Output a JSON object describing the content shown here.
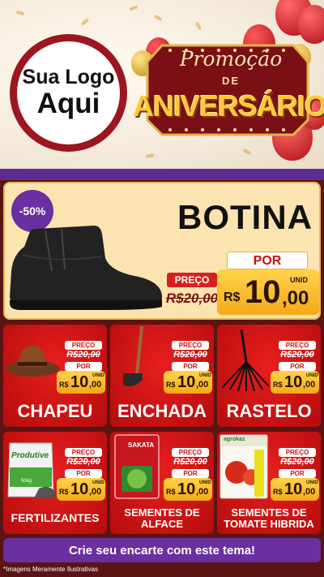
{
  "header": {
    "logo_line1": "Sua Logo",
    "logo_line2": "Aqui",
    "promo_top": "Promoção",
    "promo_de": "DE",
    "promo_main": "ANIVERSÁRIO"
  },
  "hero": {
    "discount": "-50%",
    "title": "BOTINA",
    "preco_label": "PREÇO",
    "old_price": "R$20,00",
    "por_label": "POR",
    "currency": "R$",
    "price_int": "10",
    "price_dec": ",00",
    "unit": "UNID"
  },
  "products": [
    {
      "title": "CHAPEU",
      "preco_label": "PREÇO",
      "old_price": "R$20,00",
      "por_label": "POR",
      "currency": "R$",
      "price_int": "10",
      "price_dec": ",00",
      "unit": "UNID"
    },
    {
      "title": "ENCHADA",
      "preco_label": "PREÇO",
      "old_price": "R$20,00",
      "por_label": "POR",
      "currency": "R$",
      "price_int": "10",
      "price_dec": ",00",
      "unit": "UNID"
    },
    {
      "title": "RASTELO",
      "preco_label": "PREÇO",
      "old_price": "R$20,00",
      "por_label": "POR",
      "currency": "R$",
      "price_int": "10",
      "price_dec": ",00",
      "unit": "UNID"
    },
    {
      "title": "FERTILIZANTES",
      "preco_label": "PREÇO",
      "old_price": "R$20,00",
      "por_label": "POR",
      "currency": "R$",
      "price_int": "10",
      "price_dec": ",00",
      "unit": "UNID",
      "pack_brand": "Produtive",
      "pack_weight": "50kg"
    },
    {
      "title_line1": "SEMENTES DE",
      "title_line2": "ALFACE",
      "preco_label": "PREÇO",
      "old_price": "R$20,00",
      "por_label": "POR",
      "currency": "R$",
      "price_int": "10",
      "price_dec": ",00",
      "unit": "UNID",
      "pack_brand": "SAKATA"
    },
    {
      "title_line1": "SEMENTES DE",
      "title_line2": "TOMATE HIBRIDA",
      "preco_label": "PREÇO",
      "old_price": "R$20,00",
      "por_label": "POR",
      "currency": "R$",
      "price_int": "10",
      "price_dec": ",00",
      "unit": "UNID",
      "pack_brand": "agrokaz"
    }
  ],
  "cta": "Crie seu encarte com este tema!",
  "footer_note": "*Imagens Meramente Ilustrativas",
  "colors": {
    "red": "#d62020",
    "purple": "#6a2fa0",
    "gold": "#ffd34a",
    "cream": "#fbe4b0"
  }
}
